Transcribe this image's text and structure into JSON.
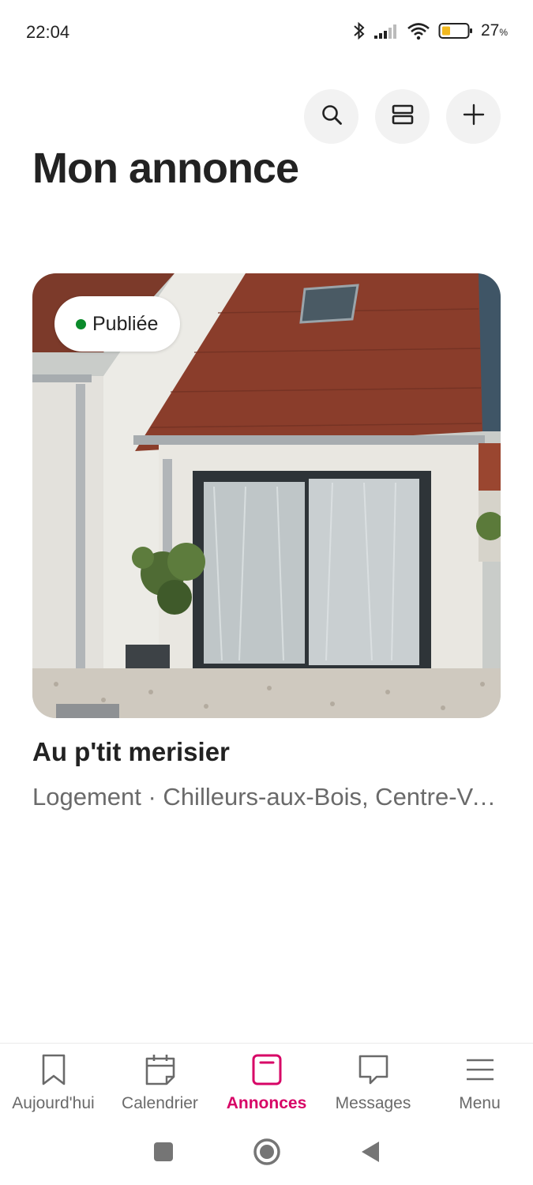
{
  "status_bar": {
    "time": "22:04",
    "battery_percent": "27",
    "battery_unit": "%",
    "icons": [
      "bluetooth-icon",
      "signal-icon",
      "wifi-icon",
      "battery-icon"
    ]
  },
  "header": {
    "title": "Mon annonce",
    "actions": [
      "search-icon",
      "layout-icon",
      "plus-icon"
    ]
  },
  "listing": {
    "status": "Publiée",
    "status_color": "#0a8a2a",
    "title": "Au p'tit merisier",
    "subtitle": "Logement · Chilleurs-aux-Bois, Centre-Val de Loire"
  },
  "bottom_nav": {
    "active_color": "#d70466",
    "items": [
      {
        "label": "Aujourd'hui",
        "icon": "bookmark-icon"
      },
      {
        "label": "Calendrier",
        "icon": "calendar-icon"
      },
      {
        "label": "Annonces",
        "icon": "listing-icon",
        "active": true
      },
      {
        "label": "Messages",
        "icon": "message-icon"
      },
      {
        "label": "Menu",
        "icon": "menu-icon"
      }
    ]
  },
  "system_nav": [
    "recents-icon",
    "home-icon",
    "back-icon"
  ]
}
